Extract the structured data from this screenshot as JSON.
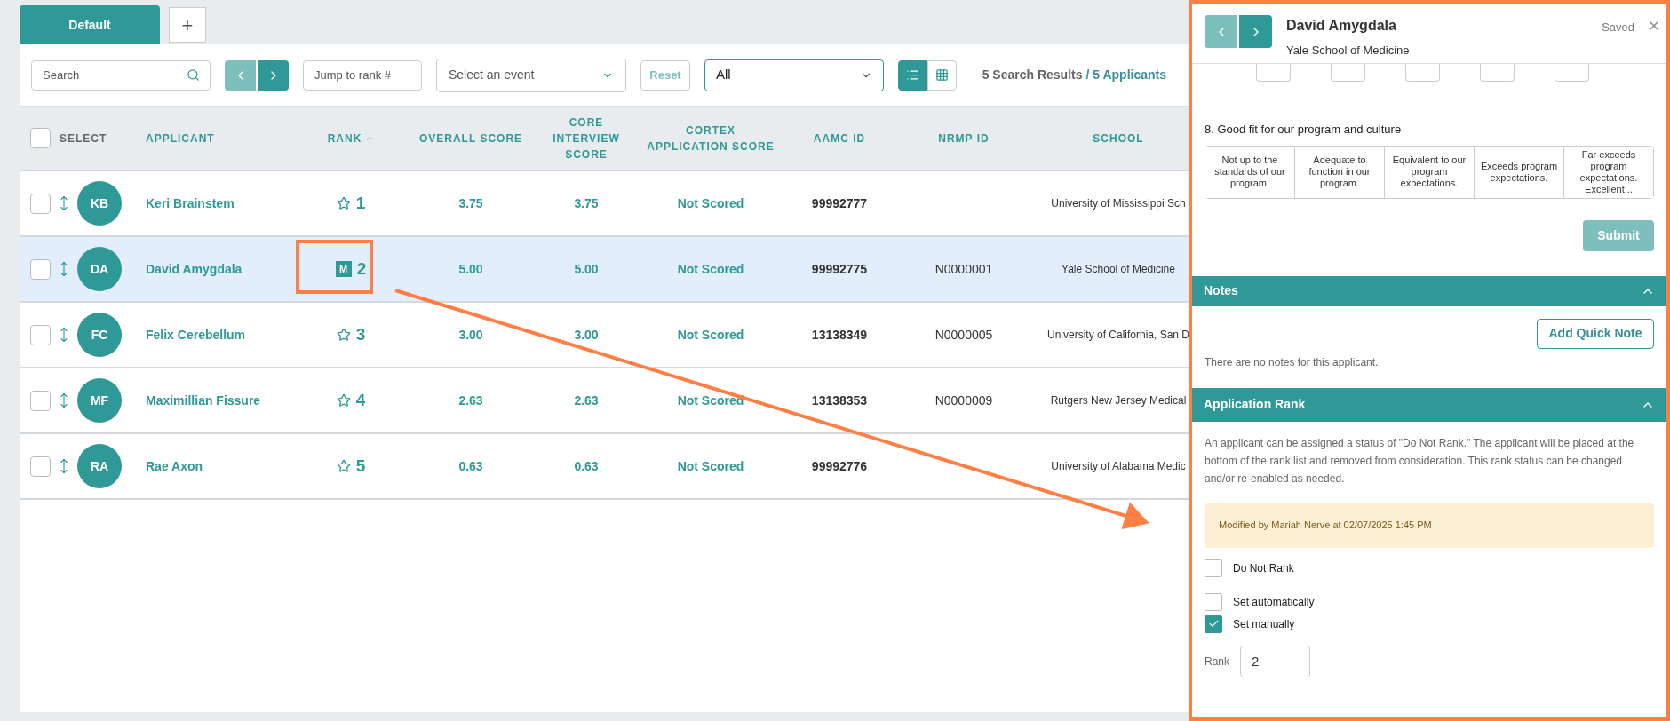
{
  "tabs": [
    {
      "label": "Default",
      "selected": true
    }
  ],
  "add_tab": "+",
  "toolbar": {
    "search": {
      "placeholder": "Search"
    },
    "jump": {
      "placeholder": "Jump to rank #"
    },
    "event_select": {
      "placeholder": "Select an event"
    },
    "reset": "Reset",
    "filter_select": {
      "value": "All"
    },
    "views": [
      {
        "kind": "list",
        "selected": true
      },
      {
        "kind": "grid",
        "selected": false
      }
    ],
    "results": "5 Search Results",
    "applicants": "/ 5 Applicants"
  },
  "table": {
    "select_all": {
      "checked": false
    },
    "select_label": "SELECT",
    "columns": [
      "APPLICANT",
      "RANK",
      "OVERALL SCORE",
      "CORE INTERVIEW SCORE",
      "CORTEX APPLICATION SCORE",
      "AAMC ID",
      "NRMP ID",
      "SCHOOL"
    ],
    "rows": [
      {
        "initials": "KB",
        "name": "Keri Brainstem",
        "kind": "star",
        "rank": "1",
        "overall": "3.75",
        "core": "3.75",
        "cortex": "Not Scored",
        "aamc": "99992777",
        "nrmp": "",
        "school": "University of Mississippi Sch",
        "selected": false,
        "checked": false
      },
      {
        "initials": "DA",
        "name": "David Amygdala",
        "kind": "manual",
        "rank_badge": "M",
        "rank": "2",
        "overall": "5.00",
        "core": "5.00",
        "cortex": "Not Scored",
        "aamc": "99992775",
        "nrmp": "N0000001",
        "school": "Yale School of Medicine",
        "selected": true,
        "checked": false
      },
      {
        "initials": "FC",
        "name": "Felix Cerebellum",
        "kind": "star",
        "rank": "3",
        "overall": "3.00",
        "core": "3.00",
        "cortex": "Not Scored",
        "aamc": "13138349",
        "nrmp": "N0000005",
        "school": "University of California, San D",
        "selected": false,
        "checked": false
      },
      {
        "initials": "MF",
        "name": "Maximillian Fissure",
        "kind": "star",
        "rank": "4",
        "overall": "2.63",
        "core": "2.63",
        "cortex": "Not Scored",
        "aamc": "13138353",
        "nrmp": "N0000009",
        "school": "Rutgers New Jersey Medical",
        "selected": false,
        "checked": false
      },
      {
        "initials": "RA",
        "name": "Rae Axon",
        "kind": "star",
        "rank": "5",
        "overall": "0.63",
        "core": "0.63",
        "cortex": "Not Scored",
        "aamc": "99992776",
        "nrmp": "",
        "school": "University of Alabama Medic",
        "selected": false,
        "checked": false
      }
    ]
  },
  "panel": {
    "name": "David Amygdala",
    "school": "Yale School of Medicine",
    "status": "Saved",
    "score_boxes": [
      {
        "selected": false
      },
      {
        "selected": false
      },
      {
        "selected": false
      },
      {
        "selected": false
      },
      {
        "selected": false
      }
    ],
    "question": "8. Good fit for our program and culture",
    "options": [
      {
        "label": "Not up to the standards of our program.",
        "selected": false
      },
      {
        "label": "Adequate to function in our program.",
        "selected": false
      },
      {
        "label": "Equivalent to our program expectations.",
        "selected": false
      },
      {
        "label": "Exceeds program expectations.",
        "selected": false
      },
      {
        "label": "Far exceeds program expectations. Excellent...",
        "selected": false
      }
    ],
    "submit": {
      "label": "Submit",
      "disabled": true
    },
    "notes": {
      "title": "Notes",
      "expanded": true,
      "add": "Add Quick Note",
      "empty": "There are no notes for this applicant."
    },
    "rank_section": {
      "title": "Application Rank",
      "expanded": true,
      "description": "An applicant can be assigned a status of \"Do Not Rank.\" The applicant will be placed at the bottom of the rank list and removed from consideration. This rank status can be changed and/or re-enabled as needed.",
      "modified": "Modified by Mariah Nerve at 02/07/2025 1:45 PM",
      "checks": [
        {
          "label": "Do Not Rank",
          "checked": false
        },
        {
          "label": "Set automatically",
          "checked": false
        },
        {
          "label": "Set manually",
          "checked": true
        }
      ],
      "rank_label": "Rank",
      "rank_value": "2"
    }
  }
}
